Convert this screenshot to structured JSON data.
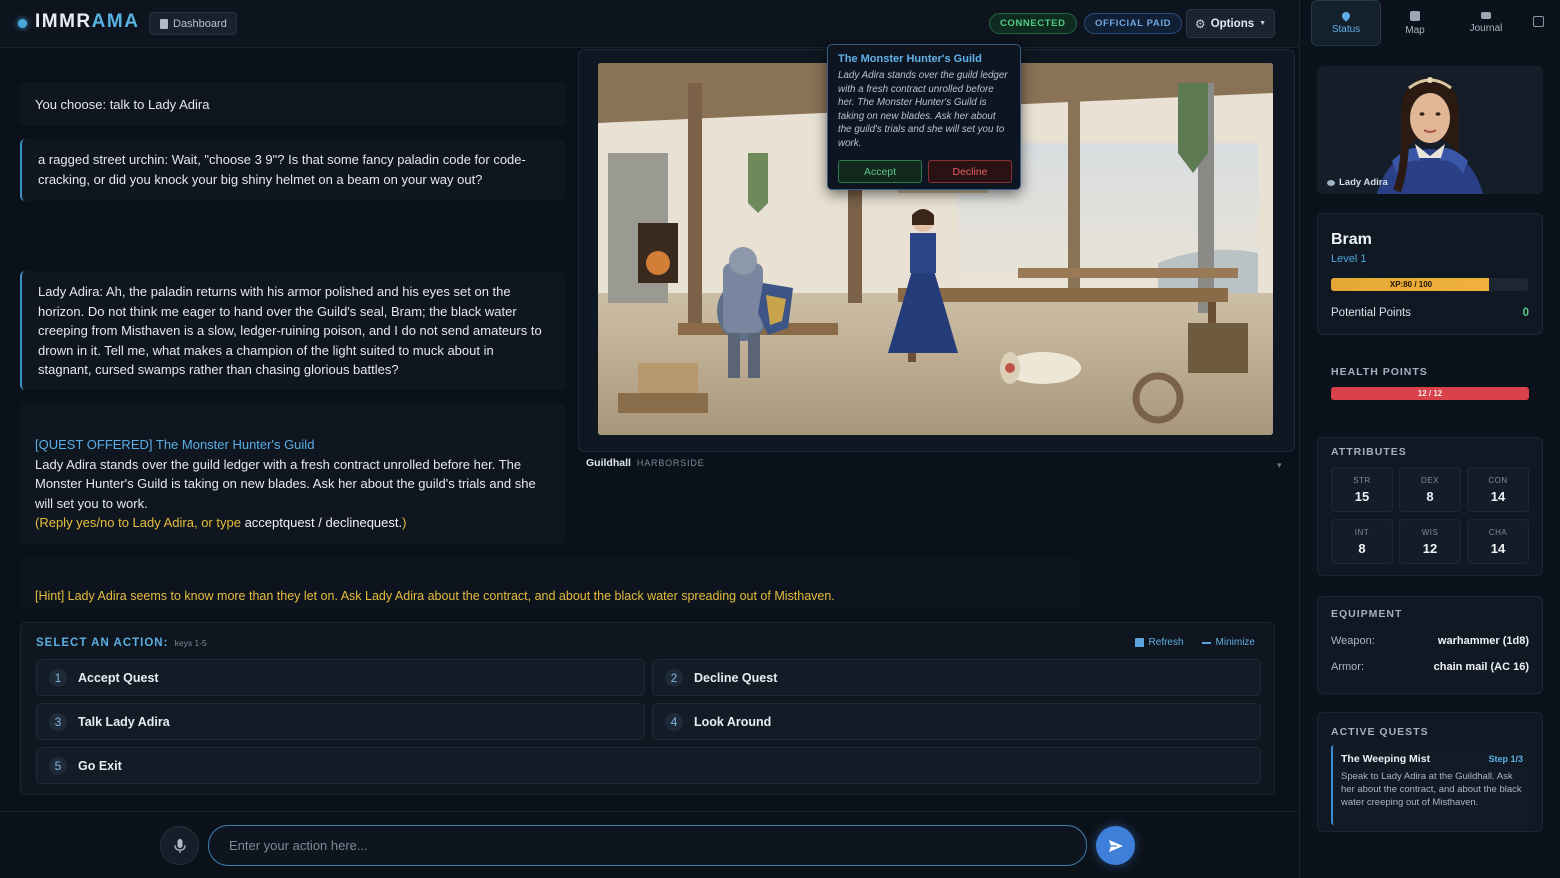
{
  "app": {
    "logo_main": "IMMR",
    "logo_accent": "AMA",
    "dashboard_label": "Dashboard",
    "status_connected": "CONNECTED",
    "status_paid": "OFFICIAL PAID",
    "options_label": "Options"
  },
  "messages": {
    "choice": "You choose: talk to Lady Adira",
    "urchin": "a ragged street urchin: Wait, \"choose 3 9\"? Is that some fancy paladin code for code-cracking, or did you knock your big shiny helmet on a beam on your way out?",
    "adira": "Lady Adira: Ah, the paladin returns with his armor polished and his eyes set on the horizon. Do not think me eager to hand over the Guild's seal, Bram; the black water creeping from Misthaven is a slow, ledger-ruining poison, and I do not send amateurs to drown in it. Tell me, what makes a champion of the light suited to muck about in stagnant, cursed swamps rather than chasing glorious battles?",
    "quest_offer_title": "[QUEST OFFERED] The Monster Hunter's Guild",
    "quest_offer_body": "Lady Adira stands over the guild ledger with a fresh contract unrolled before her. The Monster Hunter's Guild is taking on new blades. Ask her about the guild's trials and she will set you to work.",
    "quest_offer_reply_a": "(Reply yes/no to Lady Adira, or type ",
    "quest_offer_reply_cmd": "acceptquest / declinequest.",
    "quest_offer_reply_b": ")",
    "hint": "[Hint] Lady Adira seems to know more than they let on. Ask Lady Adira about the contract, and about the black water spreading out of Misthaven."
  },
  "scene": {
    "location": "Guildhall",
    "sublocation": "HARBORSIDE"
  },
  "popup": {
    "title": "The Monster Hunter's Guild",
    "body": "Lady Adira stands over the guild ledger with a fresh contract unrolled before her. The Monster Hunter's Guild is taking on new blades. Ask her about the guild's trials and she will set you to work.",
    "accept": "Accept",
    "decline": "Decline"
  },
  "actions": {
    "header": "SELECT AN ACTION:",
    "keys": "keys 1-5",
    "refresh": "Refresh",
    "minimize": "Minimize",
    "items": [
      {
        "num": "1",
        "label": "Accept Quest"
      },
      {
        "num": "2",
        "label": "Decline Quest"
      },
      {
        "num": "3",
        "label": "Talk Lady Adira"
      },
      {
        "num": "4",
        "label": "Look Around"
      },
      {
        "num": "5",
        "label": "Go Exit"
      }
    ]
  },
  "input": {
    "placeholder": "Enter your action here..."
  },
  "sidebar": {
    "tabs": [
      "Status",
      "Map",
      "Journal"
    ],
    "portrait_label": "Lady Adira",
    "char_name": "Bram",
    "char_level": "Level 1",
    "xp_text": "XP:80 / 100",
    "xp_fraction": 0.8,
    "potential_points_label": "Potential Points",
    "potential_points": "0",
    "hp_title": "HEALTH POINTS",
    "hp_text": "12 / 12",
    "hp_fraction": 1.0,
    "attributes_title": "ATTRIBUTES",
    "attributes": [
      {
        "name": "STR",
        "value": "15"
      },
      {
        "name": "DEX",
        "value": "8"
      },
      {
        "name": "CON",
        "value": "14"
      },
      {
        "name": "INT",
        "value": "8"
      },
      {
        "name": "WIS",
        "value": "12"
      },
      {
        "name": "CHA",
        "value": "14"
      }
    ],
    "equipment_title": "EQUIPMENT",
    "weapon_label": "Weapon:",
    "weapon": "warhammer (1d8)",
    "armor_label": "Armor:",
    "armor": "chain mail (AC 16)",
    "quests_title": "ACTIVE QUESTS",
    "quest_name": "The Weeping Mist",
    "quest_step": "Step 1/3",
    "quest_desc": "Speak to Lady Adira at the Guildhall. Ask her about the contract, and about the black water creeping out of Misthaven."
  },
  "colors": {
    "accent": "#5aafe2",
    "success": "#52cc86",
    "danger": "#d9424a",
    "warning": "#e7bf3d",
    "xp": "#f0b23c"
  },
  "icons": [
    "dashboard-icon",
    "gear-icon",
    "chevron-down-icon",
    "refresh-icon",
    "minimize-icon",
    "microphone-icon",
    "send-icon",
    "status-icon",
    "map-icon",
    "journal-icon",
    "popout-icon",
    "eye-icon"
  ]
}
